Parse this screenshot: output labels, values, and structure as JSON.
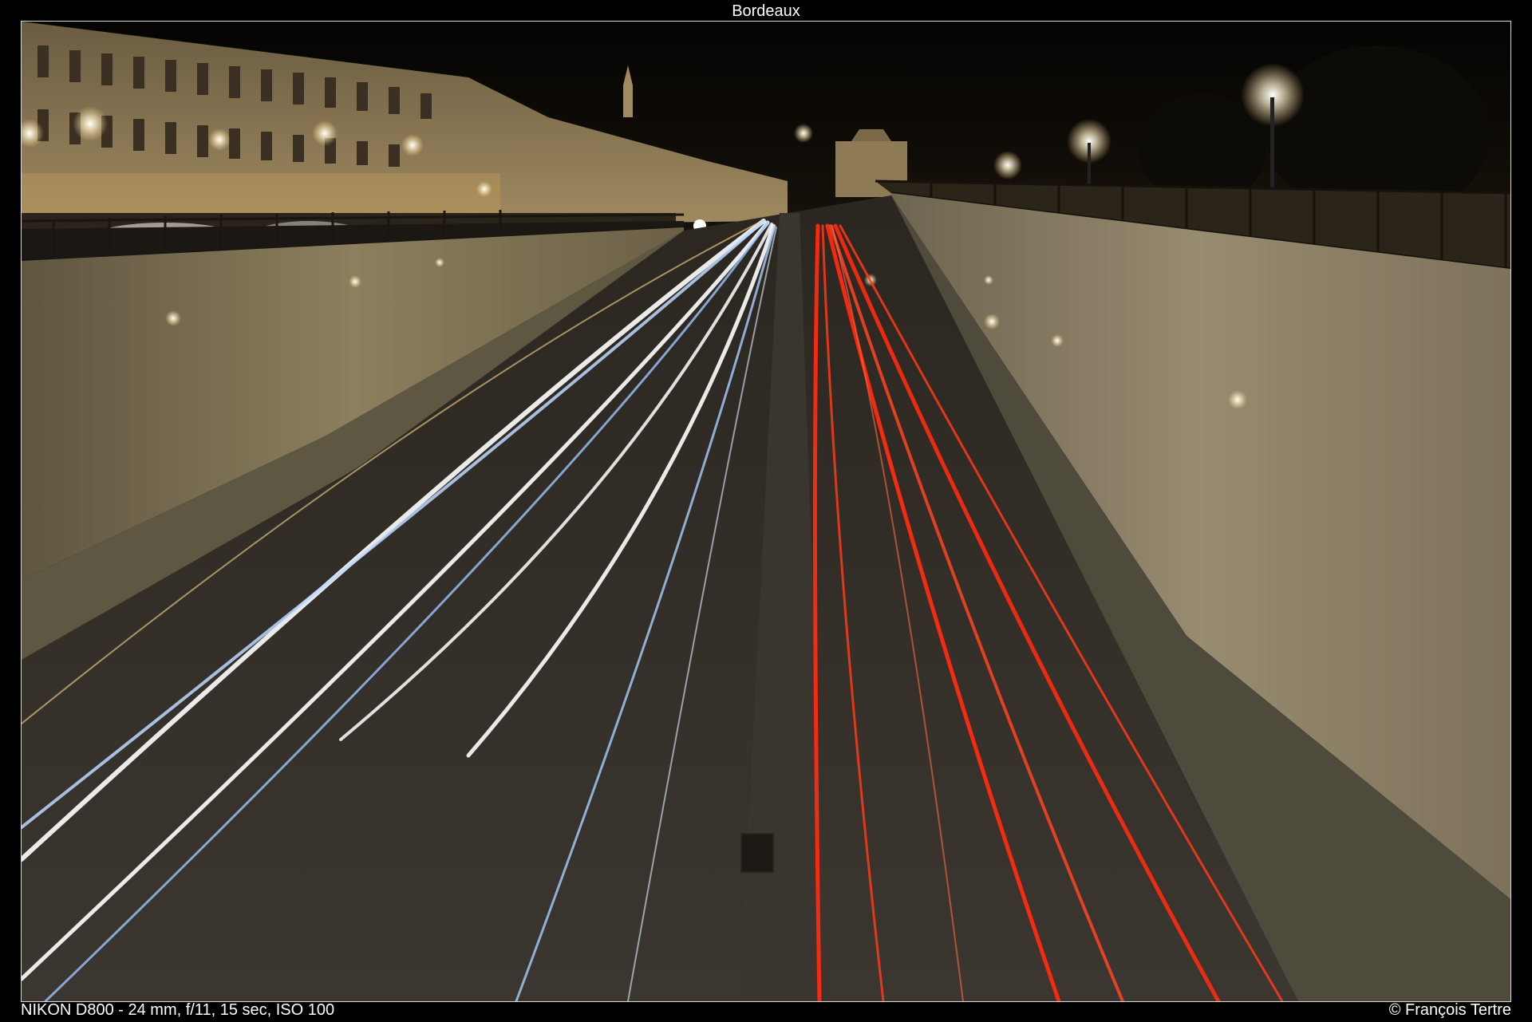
{
  "title": "Bordeaux",
  "caption": {
    "exif": "NIKON D800 - 24 mm, f/11, 15 sec, ISO 100",
    "copyright": "© François Tertre"
  },
  "colors": {
    "background": "#000000",
    "border": "#d8d8d8",
    "text": "#ffffff",
    "headlight_trail": "#e8f2ff",
    "taillight_trail": "#ff2a10",
    "wall": "#8a7f63",
    "sky": "#0a0806"
  }
}
